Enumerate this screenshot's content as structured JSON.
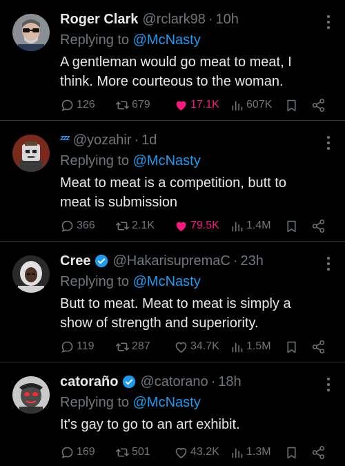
{
  "colors": {
    "accent": "#1d9bf0",
    "like": "#f91880",
    "muted": "#71767b",
    "text": "#e7e9ea",
    "border": "#2f3336"
  },
  "replies": [
    {
      "name": "Roger Clark",
      "handle": "@rclark98",
      "time": "10h",
      "reply_prefix": "Replying to",
      "reply_to": "@McNasty",
      "text": "A gentleman would go meat to meat, I think. More courteous to the woman.",
      "stats": {
        "replies": "126",
        "reposts": "679",
        "likes": "17.1K",
        "views": "607K"
      },
      "liked": true,
      "verified": false
    },
    {
      "name": "",
      "handle": "@yozahir",
      "time": "1d",
      "reply_prefix": "Replying to",
      "reply_to": "@McNasty",
      "text": "Meat to meat is a competition, butt to meat is submission",
      "stats": {
        "replies": "366",
        "reposts": "2.1K",
        "likes": "79.5K",
        "views": "1.4M"
      },
      "liked": true,
      "verified": false
    },
    {
      "name": "Cree",
      "handle": "@HakarisupremaC",
      "time": "23h",
      "reply_prefix": "Replying to",
      "reply_to": "@McNasty",
      "text": "Butt to meat. Meat to meat is simply a show of strength and superiority.",
      "stats": {
        "replies": "119",
        "reposts": "287",
        "likes": "34.7K",
        "views": "1.5M"
      },
      "liked": false,
      "verified": true
    },
    {
      "name": "catoraño",
      "handle": "@catorano",
      "time": "18h",
      "reply_prefix": "Replying to",
      "reply_to": "@McNasty",
      "text": "It's gay to go to an art exhibit.",
      "stats": {
        "replies": "169",
        "reposts": "501",
        "likes": "43.2K",
        "views": "1.3M"
      },
      "liked": false,
      "verified": true
    }
  ]
}
